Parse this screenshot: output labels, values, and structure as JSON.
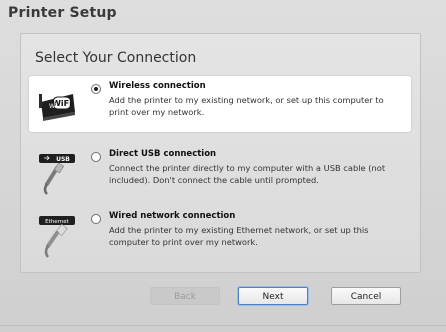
{
  "window": {
    "title": "Printer Setup"
  },
  "panel": {
    "heading": "Select Your Connection"
  },
  "options": [
    {
      "title": "Wireless connection",
      "description": "Add the printer to my existing network, or set up this computer to print over my network.",
      "selected": true,
      "icon": "wifi-router-icon",
      "icon_label": "WiFi"
    },
    {
      "title": "Direct USB connection",
      "description": "Connect the printer directly to my computer with a USB cable (not included). Don't connect the cable until prompted.",
      "selected": false,
      "icon": "usb-cable-icon",
      "icon_label": "USB"
    },
    {
      "title": "Wired network connection",
      "description": "Add the printer to my existing Ethernet network, or set up this computer to print over my network.",
      "selected": false,
      "icon": "ethernet-cable-icon",
      "icon_label": "Ethernet"
    }
  ],
  "buttons": {
    "back": "Back",
    "next": "Next",
    "cancel": "Cancel"
  }
}
